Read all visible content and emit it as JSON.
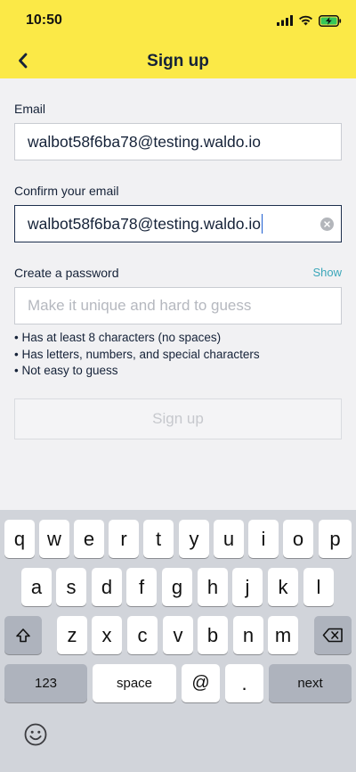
{
  "status_bar": {
    "time": "10:50"
  },
  "nav": {
    "title": "Sign up",
    "back_icon": "chevron-left-icon"
  },
  "form": {
    "email_label": "Email",
    "email_value": "walbot58f6ba78@testing.waldo.io",
    "confirm_label": "Confirm your email",
    "confirm_value": "walbot58f6ba78@testing.waldo.io",
    "password_label": "Create a password",
    "show_label": "Show",
    "password_placeholder": "Make it unique and hard to guess",
    "rules": [
      "• Has at least 8 characters (no spaces)",
      "• Has letters, numbers, and special characters",
      "• Not easy to guess"
    ],
    "signup_label": "Sign up"
  },
  "keyboard": {
    "row1": [
      "q",
      "w",
      "e",
      "r",
      "t",
      "y",
      "u",
      "i",
      "o",
      "p"
    ],
    "row2": [
      "a",
      "s",
      "d",
      "f",
      "g",
      "h",
      "j",
      "k",
      "l"
    ],
    "row3": [
      "z",
      "x",
      "c",
      "v",
      "b",
      "n",
      "m"
    ],
    "numbers_label": "123",
    "space_label": "space",
    "at_label": "@",
    "period_label": ".",
    "next_label": "next"
  },
  "colors": {
    "header": "#fbe947",
    "link": "#3aa6b9",
    "text": "#152238"
  }
}
